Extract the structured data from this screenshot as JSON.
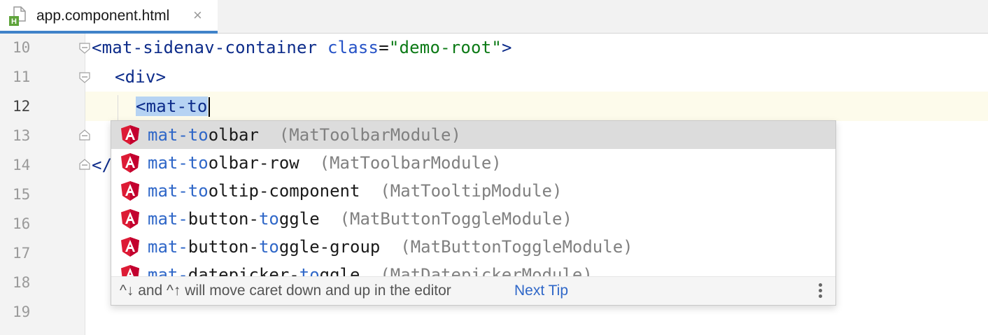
{
  "tab": {
    "label": "app.component.html",
    "close": "×",
    "icon": "html-file-icon"
  },
  "gutter": {
    "lines": [
      "10",
      "11",
      "12",
      "13",
      "14",
      "15",
      "16",
      "17",
      "18",
      "19"
    ]
  },
  "code": {
    "line10": {
      "open": "<",
      "tag": "mat-sidenav-container",
      "attr": "class",
      "eq": "=",
      "value": "\"demo-root\"",
      "close": ">"
    },
    "line11": {
      "open": "<",
      "tag": "div",
      "close": ">"
    },
    "line12": {
      "typed": "<mat-to"
    },
    "line14": {
      "partial": "</"
    }
  },
  "completion": {
    "items": [
      {
        "match": "mat-to",
        "rest": "olbar",
        "module": "(MatToolbarModule)"
      },
      {
        "match": "mat-to",
        "rest": "olbar-row",
        "module": "(MatToolbarModule)"
      },
      {
        "match": "mat-to",
        "rest": "oltip-component",
        "module": "(MatTooltipModule)"
      },
      {
        "pre": "mat-",
        "mid": "button-",
        "match2": "to",
        "rest": "ggle",
        "module": "(MatButtonToggleModule)"
      },
      {
        "pre": "mat-",
        "mid": "button-",
        "match2": "to",
        "rest": "ggle-group",
        "module": "(MatButtonToggleModule)"
      },
      {
        "pre": "mat-",
        "mid": "datepicker-",
        "match2": "to",
        "rest": "ggle",
        "module": "(MatDatepickerModule)"
      }
    ],
    "footer": {
      "tip": "^↓ and ^↑ will move caret down and up in the editor",
      "next_tip": "Next Tip"
    }
  },
  "colors": {
    "accent": "#4083c9",
    "angular": "#dd1b35",
    "match": "#2f67c8"
  }
}
